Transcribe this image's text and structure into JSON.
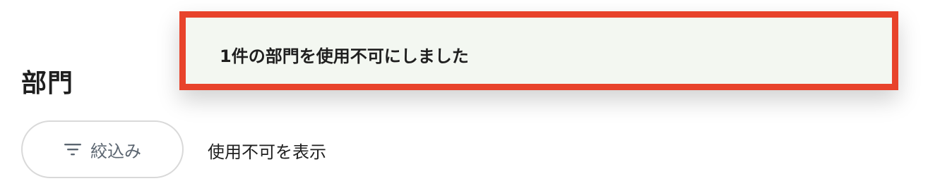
{
  "page": {
    "title": "部門"
  },
  "filter": {
    "label": "絞込み",
    "icon": "filter-icon"
  },
  "options": {
    "show_disabled_label": "使用不可を表示"
  },
  "toast": {
    "message": "1件の部門を使用不可にしました",
    "highlight_color": "#e8432b",
    "background_color": "#f3f7f1"
  }
}
